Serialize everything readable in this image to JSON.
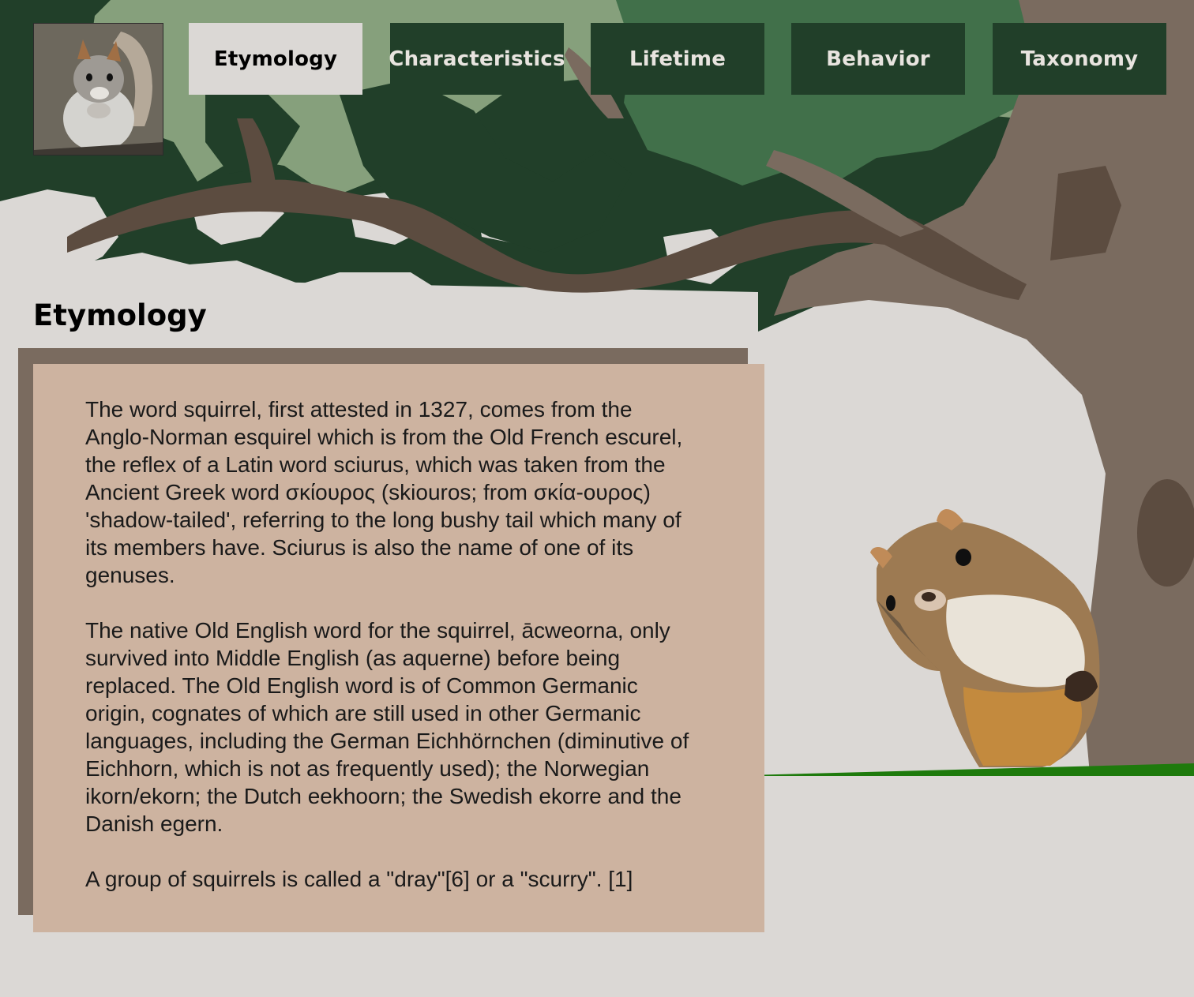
{
  "nav": {
    "tabs": [
      {
        "label": "Etymology",
        "active": true
      },
      {
        "label": "Characteristics",
        "active": false
      },
      {
        "label": "Lifetime",
        "active": false
      },
      {
        "label": "Behavior",
        "active": false
      },
      {
        "label": "Taxonomy",
        "active": false
      }
    ]
  },
  "section": {
    "title": "Etymology",
    "paragraphs": [
      "The word squirrel, first attested in 1327, comes from the Anglo-Norman esquirel which is from the Old French escurel, the reflex of a Latin word sciurus, which was taken from the Ancient Greek  word σκίουρος (skiouros; from σκία-ουρος) 'shadow-tailed', referring to the long bushy tail which many of its members have. Sciurus is also the name of one of its genuses.",
      "The native Old English word for the squirrel, ācweorna, only survived into Middle English (as aquerne) before being replaced. The Old English word is of Common Germanic origin, cognates of which are still used in other Germanic languages, including the German Eichhörnchen (diminutive of Eichhorn, which is not as frequently used); the Norwegian ikorn/ekorn; the Dutch eekhoorn; the Swedish ekorre and the Danish egern.",
      "A group of squirrels is called a \"dray\"[6] or a \"scurry\". [1]"
    ]
  },
  "colors": {
    "background": "#dbd8d5",
    "tab_bg": "#213f29",
    "tab_active_bg": "#dbd8d5",
    "panel_bg": "#cdb3a0",
    "panel_shadow": "#7a6b5f",
    "foliage_light": "#86a07c",
    "foliage_mid": "#41704a",
    "foliage_dark": "#213f29",
    "bark": "#7a6b5f",
    "bark_dark": "#5c4c40",
    "grass": "#1e7a0c"
  }
}
